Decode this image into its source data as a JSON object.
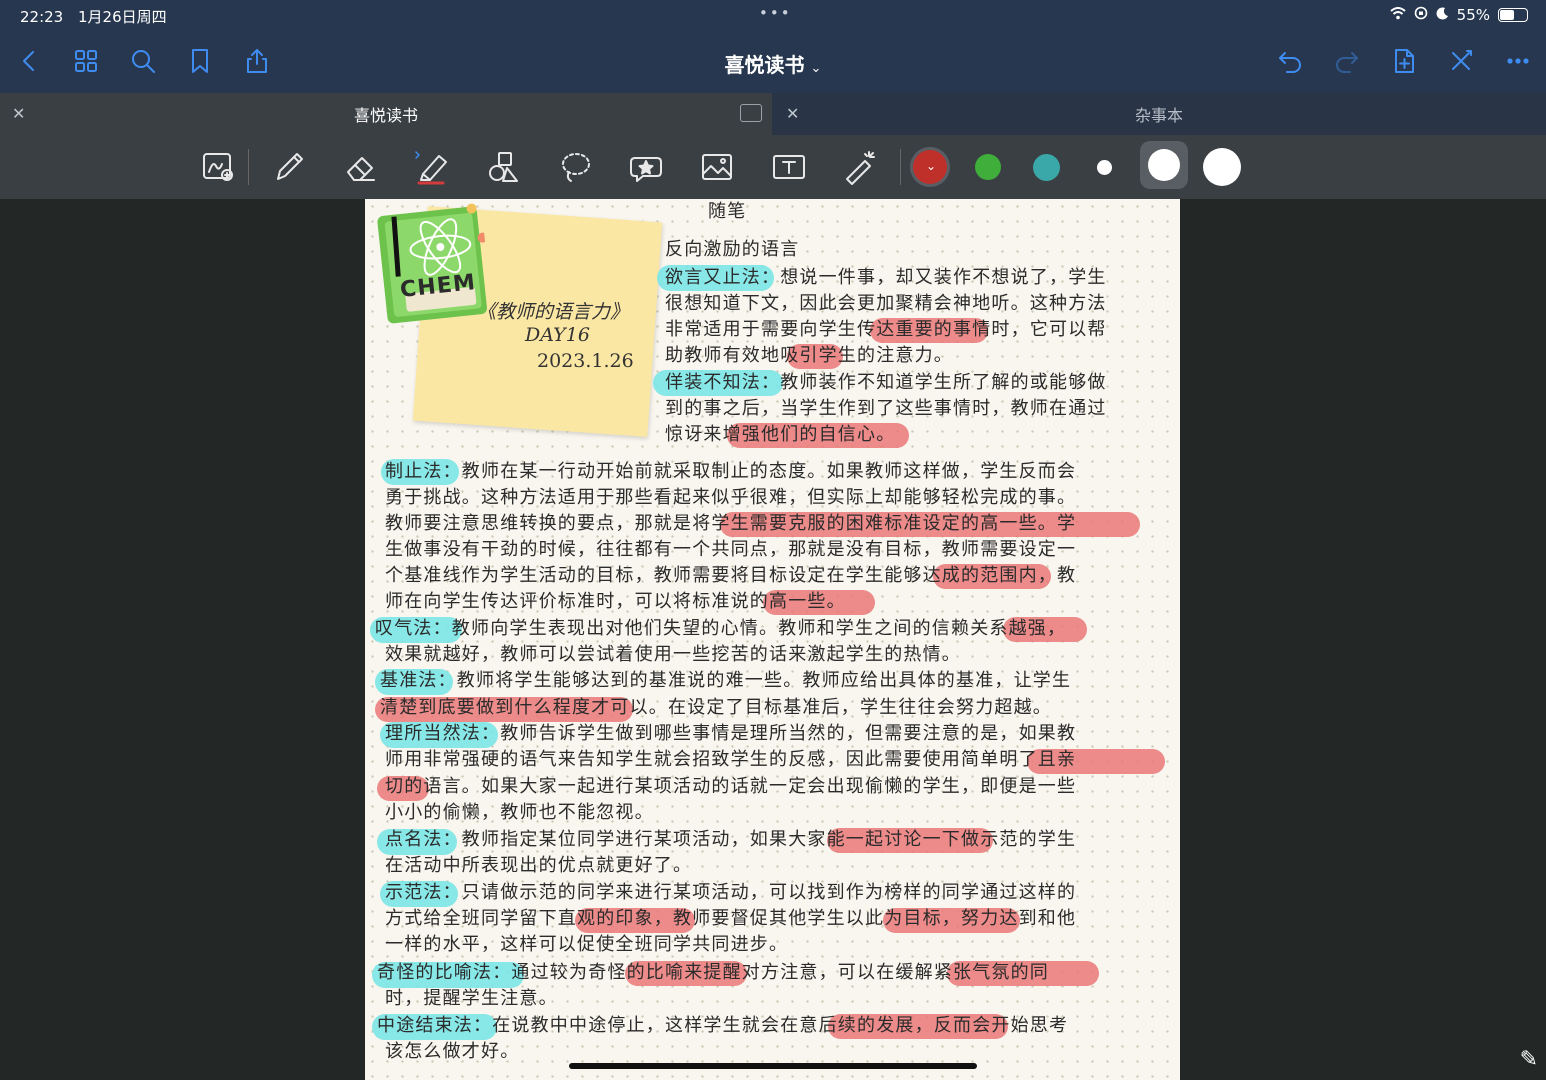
{
  "status": {
    "time": "22:23",
    "date": "1月26日周四",
    "dots": "•••",
    "battery": "55%",
    "battery_level": 0.55
  },
  "nav": {
    "title": "喜悦读书"
  },
  "tabs": [
    {
      "label": "喜悦读书",
      "active": true
    },
    {
      "label": "杂事本",
      "active": false
    }
  ],
  "colors": {
    "accent": "#3f8cf0",
    "swatch_red": "#c0302a",
    "swatch_green": "#3fae3a",
    "swatch_teal": "#3aa8a8",
    "swatch_white": "#ffffff",
    "highlight_cyan": "#7be5e6",
    "highlight_red": "#ea7878"
  },
  "sticky": {
    "sticker_text": "CHEM",
    "title": "《教师的语言力》",
    "day": "DAY16",
    "date": "2023.1.26"
  },
  "note": {
    "heading": "随笔",
    "subheading": "反向激励的语言",
    "lines": [
      "欲言又止法：想说一件事，却又装作不想说了，学生",
      "很想知道下文，因此会更加聚精会神地听。这种方法",
      "非常适用于需要向学生传达重要的事情时，它可以帮",
      "助教师有效地吸引学生的注意力。",
      "佯装不知法：教师装作不知道学生所了解的或能够做",
      "到的事之后，当学生作到了这些事情时，教师在通过",
      "惊讶来增强他们的自信心。",
      "制止法：教师在某一行动开始前就采取制止的态度。如果教师这样做，学生反而会",
      "勇于挑战。这种方法适用于那些看起来似乎很难，但实际上却能够轻松完成的事。",
      "教师要注意思维转换的要点，那就是将学生需要克服的困难标准设定的高一些。学",
      "生做事没有干劲的时候，往往都有一个共同点，那就是没有目标，教师需要设定一",
      "个基准线作为学生活动的目标，教师需要将目标设定在学生能够达成的范围内，教",
      "师在向学生传达评价标准时，可以将标准说的高一些。",
      "叹气法：教师向学生表现出对他们失望的心情。教师和学生之间的信赖关系越强，",
      "效果就越好，教师可以尝试着使用一些挖苦的话来激起学生的热情。",
      "基准法：教师将学生能够达到的基准说的难一些。教师应给出具体的基准，让学生",
      "清楚到底要做到什么程度才可以。在设定了目标基准后，学生往往会努力超越。",
      "理所当然法：教师告诉学生做到哪些事情是理所当然的，但需要注意的是，如果教",
      "师用非常强硬的语气来告知学生就会招致学生的反感，因此需要使用简单明了且亲",
      "切的语言。如果大家一起进行某项活动的话就一定会出现偷懒的学生，即便是一些",
      "小小的偷懒，教师也不能忽视。",
      "点名法：教师指定某位同学进行某项活动，如果大家能一起讨论一下做示范的学生",
      "在活动中所表现出的优点就更好了。",
      "示范法：只请做示范的同学来进行某项活动，可以找到作为榜样的同学通过这样的",
      "方式给全班同学留下直观的印象，教师要督促其他学生以此为目标，努力达到和他",
      "一样的水平，这样可以促使全班同学共同进步。",
      "奇怪的比喻法：通过较为奇怪的比喻来提醒对方注意，可以在缓解紧张气氛的同",
      "时，提醒学生注意。",
      "中途结束法：在说教中中途停止，这样学生就会在意后续的发展，反而会开始思考",
      "该怎么做才好。"
    ]
  }
}
